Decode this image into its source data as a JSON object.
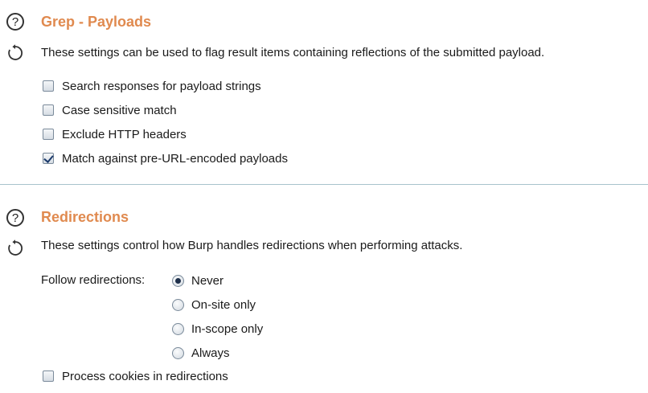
{
  "grep_payloads": {
    "title": "Grep - Payloads",
    "description": "These settings can be used to flag result items containing reflections of the submitted payload.",
    "options": [
      {
        "label": "Search responses for payload strings",
        "checked": false
      },
      {
        "label": "Case sensitive match",
        "checked": false
      },
      {
        "label": "Exclude HTTP headers",
        "checked": false
      },
      {
        "label": "Match against pre-URL-encoded payloads",
        "checked": true
      }
    ]
  },
  "redirections": {
    "title": "Redirections",
    "description": "These settings control how Burp handles redirections when performing attacks.",
    "follow_label": "Follow redirections:",
    "follow_options": [
      {
        "label": "Never",
        "selected": true
      },
      {
        "label": "On-site only",
        "selected": false
      },
      {
        "label": "In-scope only",
        "selected": false
      },
      {
        "label": "Always",
        "selected": false
      }
    ],
    "process_cookies": {
      "label": "Process cookies in redirections",
      "checked": false
    }
  },
  "icons": {
    "help": "help-icon",
    "restore": "restore-defaults-icon"
  },
  "colors": {
    "section_title": "#e08a4f",
    "divider": "#a8c3cc"
  }
}
